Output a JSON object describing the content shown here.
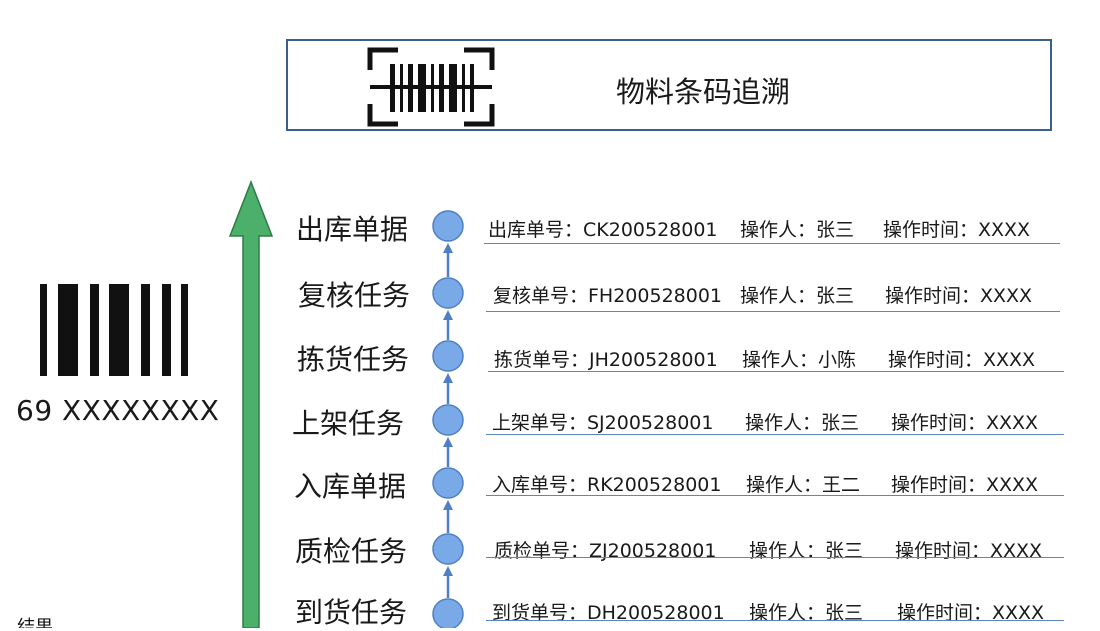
{
  "header": {
    "title": "物料条码追溯",
    "icon": "barcode-scan-icon"
  },
  "barcode": {
    "icon": "barcode-icon",
    "number": "69 XXXXXXXX"
  },
  "colors": {
    "arrow": "#4caf6a",
    "node": "#7aa9e8",
    "line": "#5b86bf",
    "border": "#3a5f8f"
  },
  "tasks": [
    {
      "label": "出库单据",
      "doc": "出库单号：CK200528001",
      "operator": "操作人：张三",
      "time": "操作时间：XXXX"
    },
    {
      "label": "复核任务",
      "doc": "复核单号：FH200528001",
      "operator": "操作人：张三",
      "time": "操作时间：XXXX"
    },
    {
      "label": "拣货任务",
      "doc": "拣货单号：JH200528001",
      "operator": "操作人：小陈",
      "time": "操作时间：XXXX"
    },
    {
      "label": "上架任务",
      "doc": "上架单号：SJ200528001",
      "operator": "操作人：张三",
      "time": "操作时间：XXXX"
    },
    {
      "label": "入库单据",
      "doc": "入库单号：RK200528001",
      "operator": "操作人：王二",
      "time": "操作时间：XXXX"
    },
    {
      "label": "质检任务",
      "doc": "质检单号：ZJ200528001",
      "operator": "操作人：张三",
      "time": "操作时间：XXXX"
    },
    {
      "label": "到货任务",
      "doc": "到货单号：DH200528001",
      "operator": "操作人：张三",
      "time": "操作时间：XXXX"
    }
  ],
  "corner_text": "...结果"
}
